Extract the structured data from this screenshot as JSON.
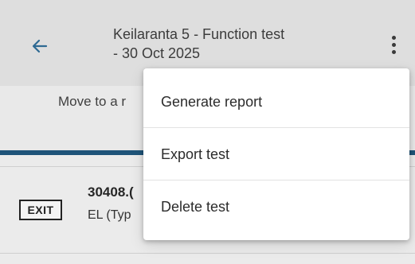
{
  "header": {
    "title": "Keilaranta 5 - Function test\n- 30 Oct 2025",
    "back_icon": "arrow-left-icon",
    "more_icon": "more-vertical-icon"
  },
  "subtext": "Move to a r",
  "item": {
    "badge": "EXIT",
    "title": "30408.(",
    "subtitle": "EL (Typ"
  },
  "menu": {
    "items": [
      {
        "label": "Generate report"
      },
      {
        "label": "Export test"
      },
      {
        "label": "Delete test"
      }
    ]
  },
  "colors": {
    "appbar": "#dedede",
    "accent_bar": "#1f5479",
    "menu_bg": "#ffffff"
  }
}
